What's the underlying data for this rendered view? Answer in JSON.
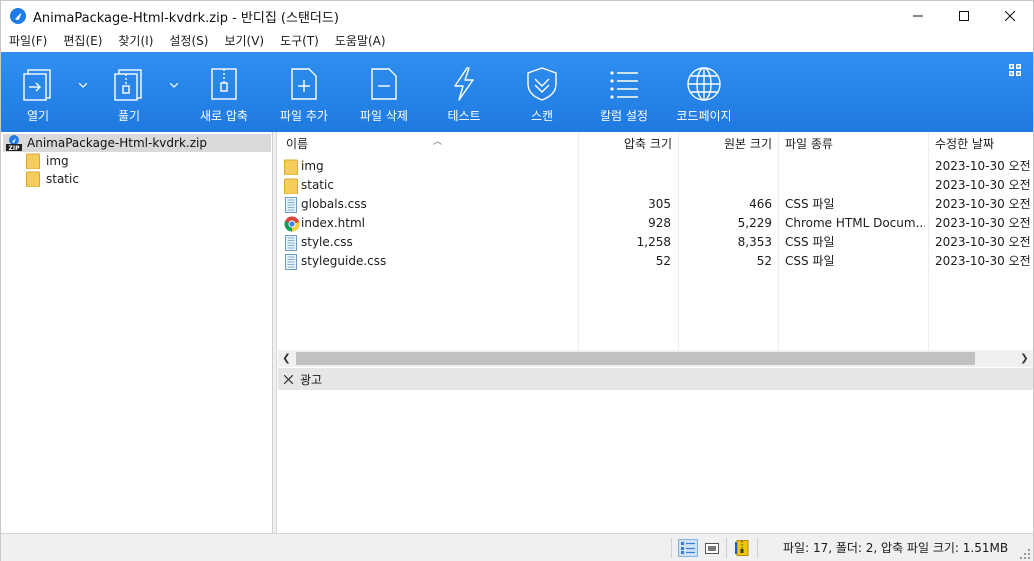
{
  "window": {
    "title": "AnimaPackage-Html-kvdrk.zip - 반디집 (스탠더드)"
  },
  "menu": [
    "파일(F)",
    "편집(E)",
    "찾기(I)",
    "설정(S)",
    "보기(V)",
    "도구(T)",
    "도움말(A)"
  ],
  "toolbar": {
    "open": "열기",
    "extract": "풀기",
    "new_archive": "새로 압축",
    "add_file": "파일 추가",
    "delete_file": "파일 삭제",
    "test": "테스트",
    "scan": "스캔",
    "column_settings": "칼럼 설정",
    "codepage": "코드페이지"
  },
  "tree": {
    "root": "AnimaPackage-Html-kvdrk.zip",
    "children": [
      "img",
      "static"
    ]
  },
  "list": {
    "columns": {
      "name": "이름",
      "packed": "압축 크기",
      "size": "원본 크기",
      "type": "파일 종류",
      "modified": "수정한 날짜"
    },
    "rows": [
      {
        "icon": "folder-icon",
        "name": "img",
        "packed": "",
        "size": "",
        "type": "",
        "modified": "2023-10-30 오전"
      },
      {
        "icon": "folder-icon",
        "name": "static",
        "packed": "",
        "size": "",
        "type": "",
        "modified": "2023-10-30 오전"
      },
      {
        "icon": "css-file-icon",
        "name": "globals.css",
        "packed": "305",
        "size": "466",
        "type": "CSS 파일",
        "modified": "2023-10-30 오전"
      },
      {
        "icon": "chrome-html-icon",
        "name": "index.html",
        "packed": "928",
        "size": "5,229",
        "type": "Chrome HTML Docum...",
        "modified": "2023-10-30 오전"
      },
      {
        "icon": "css-file-icon",
        "name": "style.css",
        "packed": "1,258",
        "size": "8,353",
        "type": "CSS 파일",
        "modified": "2023-10-30 오전"
      },
      {
        "icon": "css-file-icon",
        "name": "styleguide.css",
        "packed": "52",
        "size": "52",
        "type": "CSS 파일",
        "modified": "2023-10-30 오전"
      }
    ]
  },
  "ad": {
    "label": "광고"
  },
  "status": {
    "text": "파일: 17, 폴더: 2, 압축 파일 크기: 1.51MB"
  },
  "colors": {
    "toolbar": "#1f7ae0",
    "selection": "#d9d9d9",
    "folder": "#f5cd5c"
  }
}
